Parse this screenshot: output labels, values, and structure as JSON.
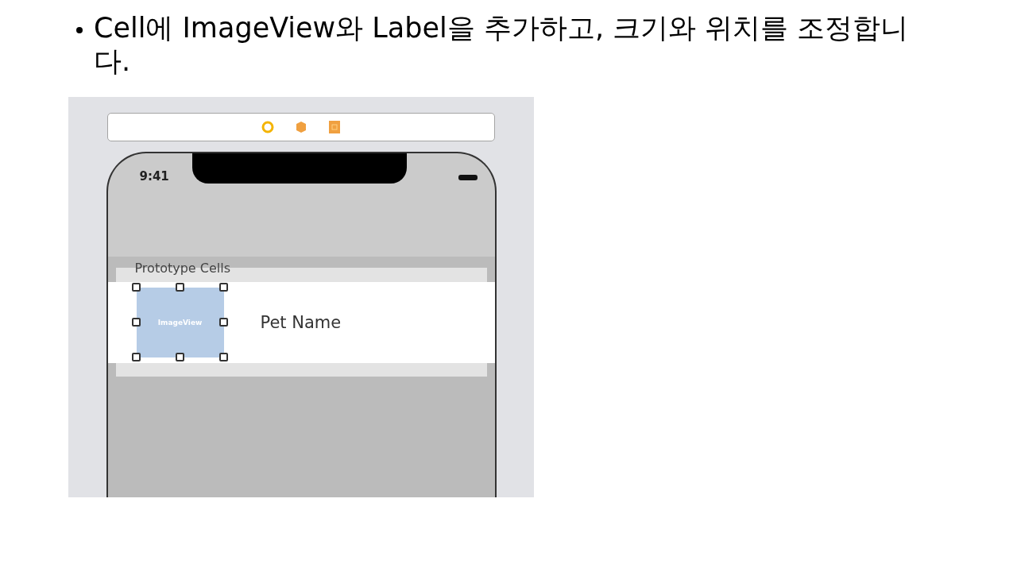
{
  "bullet": "Cell에 ImageView와 Label을 추가하고, 크기와 위치를 조정합니다.",
  "screenshot": {
    "status_time": "9:41",
    "section_header": "Prototype Cells",
    "cell": {
      "image_view_label": "ImageView",
      "selected": true,
      "label": "Pet Name"
    }
  }
}
